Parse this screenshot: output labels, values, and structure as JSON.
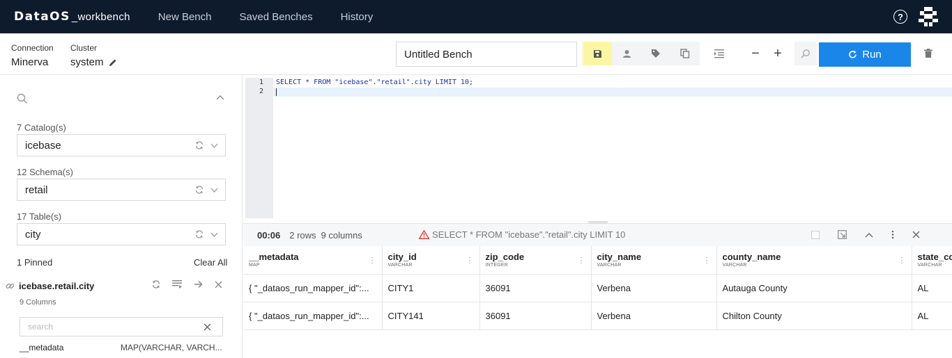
{
  "app": {
    "brand_logo": "DataOS",
    "brand_sub": "_workbench",
    "nav": [
      "New Bench",
      "Saved Benches",
      "History"
    ],
    "help_label": "?"
  },
  "connection": {
    "connection_label": "Connection",
    "connection_value": "Minerva",
    "cluster_label": "Cluster",
    "cluster_value": "system"
  },
  "toolbar": {
    "bench_title": "Untitled Bench",
    "zoom_out": "−",
    "zoom_in": "+",
    "run_label": "Run"
  },
  "sidebar": {
    "catalog_label": "7 Catalog(s)",
    "catalog_value": "icebase",
    "schema_label": "12 Schema(s)",
    "schema_value": "retail",
    "table_label": "17 Table(s)",
    "table_value": "city",
    "pinned_label": "1 Pinned",
    "clear_all": "Clear All",
    "pinned_table": "icebase.retail.city",
    "pinned_columns": "9 Columns",
    "column_search_placeholder": "search",
    "columns": [
      {
        "name": "__metadata",
        "type": "MAP(VARCHAR, VARCH..."
      }
    ]
  },
  "editor": {
    "lines": [
      {
        "num": "1",
        "text": "SELECT * FROM \"icebase\".\"retail\".city LIMIT 10;"
      },
      {
        "num": "2",
        "text": ""
      }
    ]
  },
  "results": {
    "time": "00:06",
    "rows": "2 rows",
    "cols": "9 columns",
    "query": "SELECT * FROM \"icebase\".\"retail\".city LIMIT 10",
    "warning_color": "#e53935",
    "headers": [
      {
        "name": "__metadata",
        "type": "MAP"
      },
      {
        "name": "city_id",
        "type": "VARCHAR"
      },
      {
        "name": "zip_code",
        "type": "INTEGER"
      },
      {
        "name": "city_name",
        "type": "VARCHAR"
      },
      {
        "name": "county_name",
        "type": "VARCHAR"
      },
      {
        "name": "state_co",
        "type": "VARCHAR"
      }
    ],
    "rows_data": [
      [
        "{ \"_dataos_run_mapper_id\":...",
        "CITY1",
        "36091",
        "Verbena",
        "Autauga County",
        "AL"
      ],
      [
        "{ \"_dataos_run_mapper_id\":...",
        "CITY141",
        "36091",
        "Verbena",
        "Chilton County",
        "AL"
      ]
    ]
  },
  "colors": {
    "nav_bg": "#0e1b2c",
    "run_button": "#1a86ea",
    "save_highlight": "#fbf6a3"
  }
}
